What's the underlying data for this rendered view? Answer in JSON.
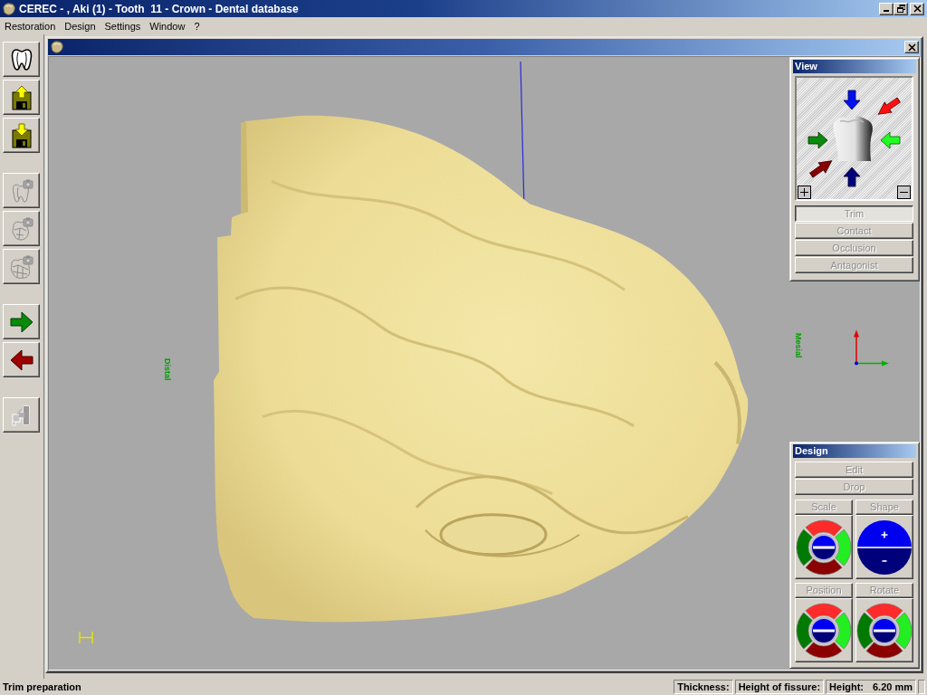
{
  "window": {
    "title": "CEREC - , Aki (1) - Tooth  11 - Crown - Dental database"
  },
  "menu": [
    "Restoration",
    "Design",
    "Settings",
    "Window",
    "?"
  ],
  "toolbar": {
    "groups": [
      [
        {
          "kind": "tooth",
          "disabled": false
        },
        {
          "kind": "floppy-up",
          "disabled": false
        },
        {
          "kind": "floppy-down",
          "disabled": false
        }
      ],
      [
        {
          "kind": "tooth-camera",
          "disabled": true
        },
        {
          "kind": "quadrant-camera",
          "disabled": true
        },
        {
          "kind": "arch-camera",
          "disabled": true
        }
      ],
      [
        {
          "kind": "arrow-right",
          "disabled": false
        },
        {
          "kind": "arrow-left",
          "disabled": false
        }
      ],
      [
        {
          "kind": "plug",
          "disabled": true
        }
      ]
    ]
  },
  "viewport": {
    "distal_label": "Distal",
    "mesial_label": "Mesial"
  },
  "view_panel": {
    "title": "View",
    "buttons": [
      {
        "label": "Trim",
        "selected": true,
        "disabled": true
      },
      {
        "label": "Contact",
        "selected": false,
        "disabled": true
      },
      {
        "label": "Occlusion",
        "selected": false,
        "disabled": true
      },
      {
        "label": "Antagonist",
        "selected": false,
        "disabled": true
      }
    ]
  },
  "design_panel": {
    "title": "Design",
    "buttons": [
      {
        "label": "Edit",
        "disabled": true
      },
      {
        "label": "Drop",
        "disabled": true
      }
    ],
    "controls": [
      {
        "label": "Scale",
        "kind": "ring",
        "disabled": true
      },
      {
        "label": "Shape",
        "kind": "disc",
        "disabled": true
      },
      {
        "label": "Position",
        "kind": "ring",
        "disabled": true
      },
      {
        "label": "Rotate",
        "kind": "ring",
        "disabled": true
      }
    ]
  },
  "status_bar": {
    "message": "Trim preparation",
    "fields": [
      {
        "label": "Thickness:"
      },
      {
        "label": "Height of fissure:"
      },
      {
        "label": "Height:",
        "value": "6.20 mm"
      }
    ]
  }
}
